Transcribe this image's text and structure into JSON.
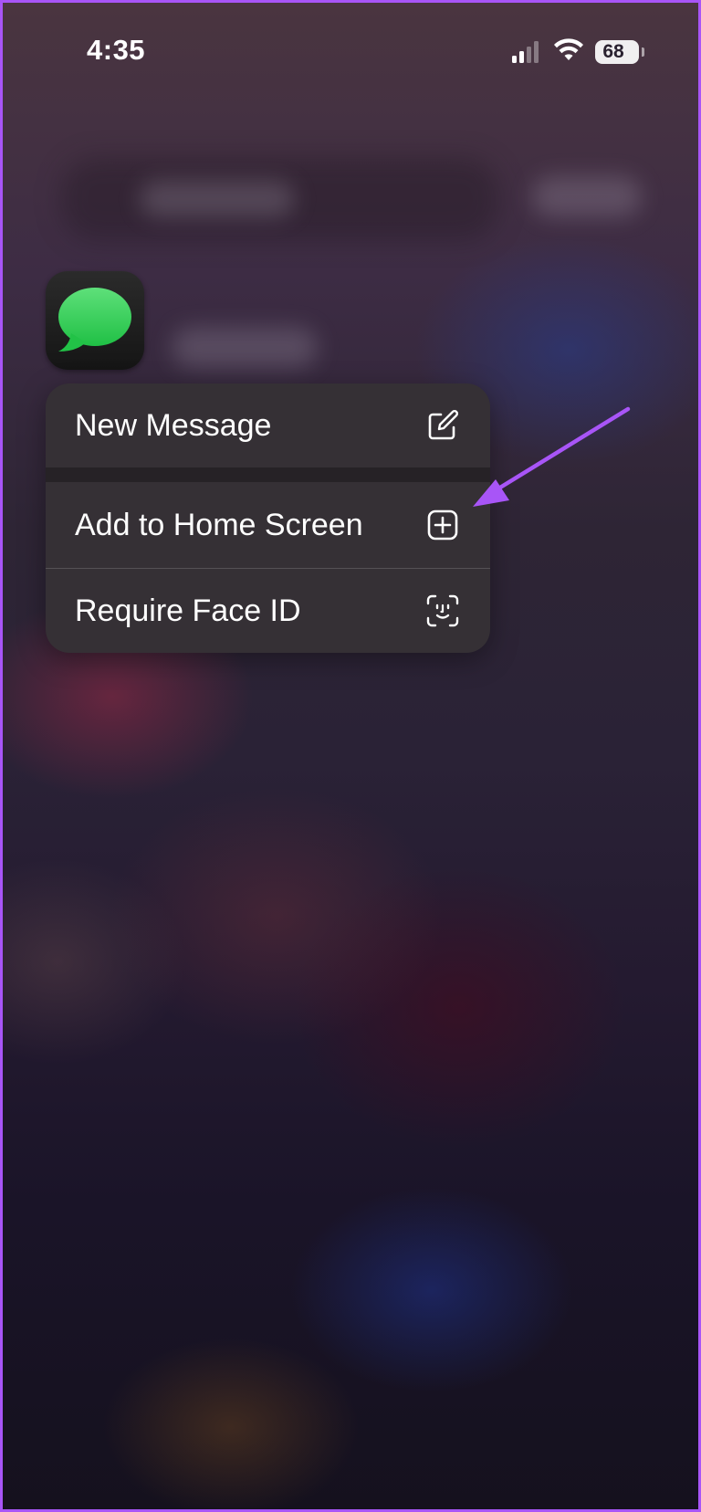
{
  "status_bar": {
    "time": "4:35",
    "battery_level": "68",
    "signal_bars_active": 2,
    "signal_bars_total": 4,
    "wifi_icon": "wifi-icon"
  },
  "app": {
    "name_icon": "messages-app-icon",
    "icon_color": "#34c759"
  },
  "context_menu": {
    "items": [
      {
        "label": "New Message",
        "icon": "compose-icon"
      },
      {
        "label": "Add to Home Screen",
        "icon": "plus-square-icon"
      },
      {
        "label": "Require Face ID",
        "icon": "face-id-icon"
      }
    ]
  },
  "annotation": {
    "arrow_color": "#a855f7",
    "frame_color": "#a855f7"
  }
}
